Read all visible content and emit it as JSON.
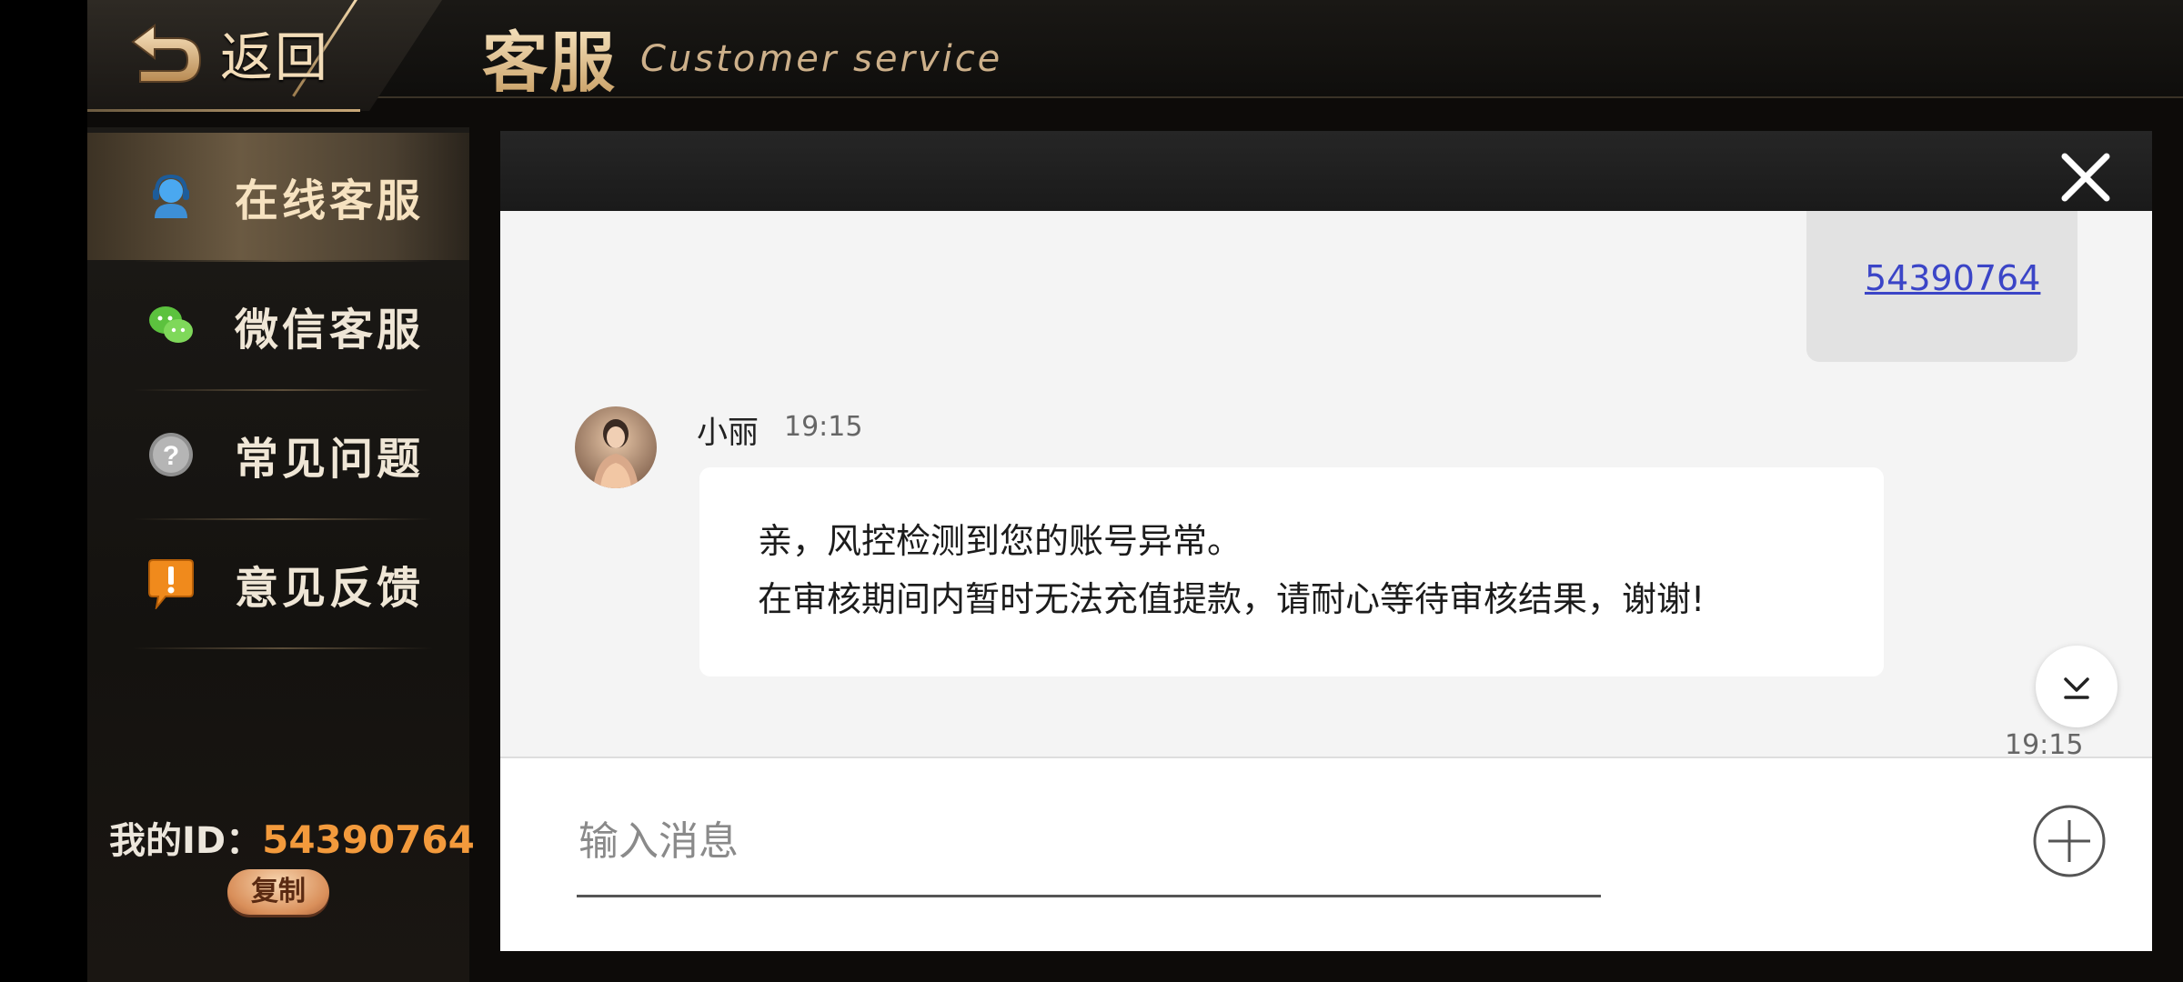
{
  "header": {
    "back_label": "返回",
    "title_cn": "客服",
    "title_en": "Customer service"
  },
  "sidebar": {
    "items": [
      {
        "label": "在线客服",
        "icon": "headset-user-icon",
        "active": true
      },
      {
        "label": "微信客服",
        "icon": "wechat-icon",
        "active": false
      },
      {
        "label": "常见问题",
        "icon": "question-icon",
        "active": false
      },
      {
        "label": "意见反馈",
        "icon": "feedback-icon",
        "active": false
      }
    ],
    "my_id_label": "我的ID：",
    "my_id_value": "54390764",
    "copy_label": "复制"
  },
  "chat": {
    "sent_message": "54390764",
    "agent_name": "小丽",
    "agent_time": "19:15",
    "agent_message_line1": "亲，风控检测到您的账号异常。",
    "agent_message_line2": "在审核期间内暂时无法充值提款，请耐心等待审核结果，谢谢!",
    "bottom_time": "19:15",
    "input_placeholder": "输入消息"
  },
  "colors": {
    "accent_gold": "#e8c998",
    "id_orange": "#f39a3c",
    "link_blue": "#3b45c7"
  }
}
